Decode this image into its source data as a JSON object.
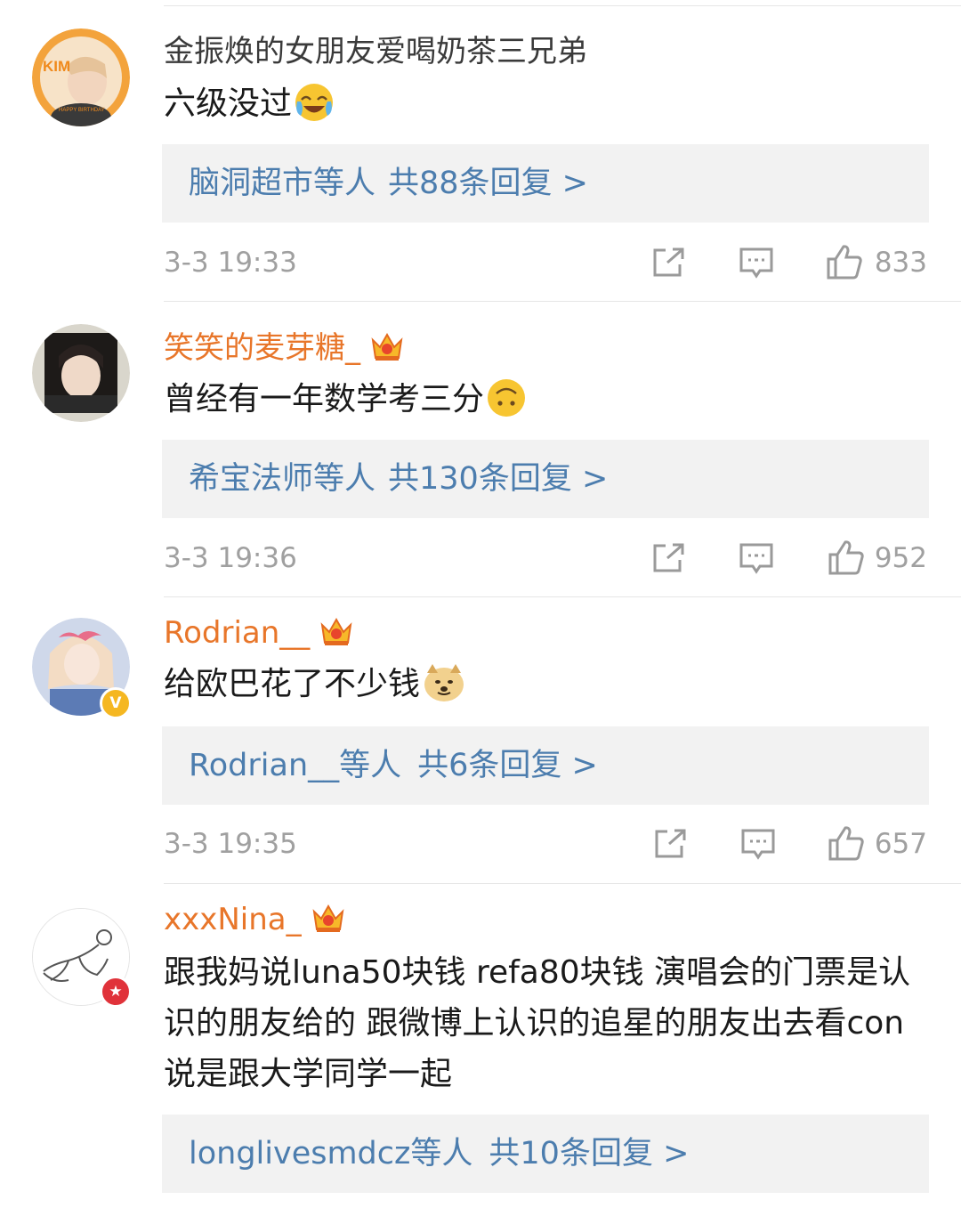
{
  "comments": [
    {
      "username": "金振焕的女朋友爱喝奶茶三兄弟",
      "text": "六级没过",
      "emoji": "laughing-crying-emoji",
      "replies_users": "脑洞超市等人",
      "replies_count": "共88条回复 >",
      "time": "3-3 19:33",
      "likes": "833"
    },
    {
      "username": "笑笑的麦芽糖_",
      "text": "曾经有一年数学考三分",
      "emoji": "upside-down-face-emoji",
      "replies_users": "希宝法师等人",
      "replies_count": "共130条回复 >",
      "time": "3-3 19:36",
      "likes": "952"
    },
    {
      "username": "Rodrian__",
      "text": "给欧巴花了不少钱",
      "emoji": "doge-emoji",
      "replies_users": "Rodrian__等人",
      "replies_count": "共6条回复 >",
      "time": "3-3 19:35",
      "likes": "657"
    },
    {
      "username": "xxxNina_",
      "text": "跟我妈说luna50块钱 refa80块钱 演唱会的门票是认识的朋友给的 跟微博上认识的追星的朋友出去看con说是跟大学同学一起",
      "replies_users": "longlivesmdcz等人",
      "replies_count": "共10条回复 >"
    }
  ],
  "avatar1_text": "KIM",
  "avatar1_caption": "HAPPY BIRTHDAY",
  "colors": {
    "link": "#4c7dae",
    "vip_name": "#e8762a",
    "meta": "#a0a0a0",
    "reply_bg": "#f2f2f2"
  }
}
